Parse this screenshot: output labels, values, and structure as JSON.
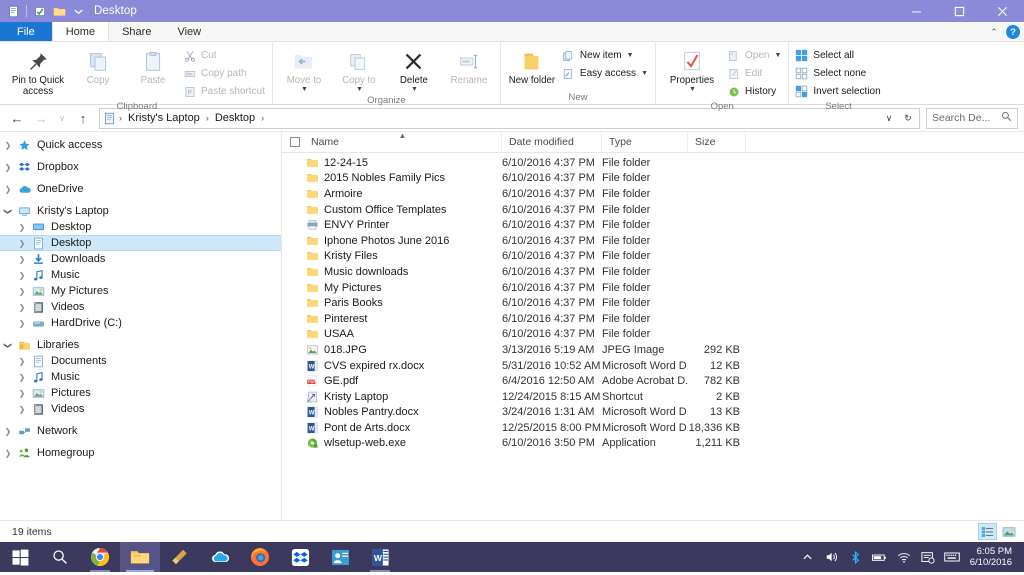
{
  "window": {
    "title": "Desktop",
    "titlebar_color": "#8a8ad8",
    "quick_access": [
      {
        "name": "properties-icon",
        "label": "Properties"
      },
      {
        "name": "new-folder-check-icon",
        "label": "New folder"
      },
      {
        "name": "folder-icon",
        "label": "Folder"
      },
      {
        "name": "customize-dropdown-icon",
        "label": "Customize Quick Access Toolbar"
      }
    ],
    "controls": {
      "minimize": "─",
      "maximize": "❐",
      "close": "✕"
    }
  },
  "tabs": [
    {
      "label": "File",
      "kind": "file"
    },
    {
      "label": "Home",
      "kind": "active"
    },
    {
      "label": "Share",
      "kind": "normal"
    },
    {
      "label": "View",
      "kind": "normal"
    }
  ],
  "ribbon_controls": {
    "collapse": "⌃",
    "help": "?"
  },
  "ribbon": {
    "groups": [
      {
        "label": "Clipboard",
        "big": [
          {
            "label": "Pin to Quick access",
            "icon": "pin-icon",
            "dim": false
          },
          {
            "label": "Copy",
            "icon": "copy-icon",
            "dim": true
          },
          {
            "label": "Paste",
            "icon": "paste-icon",
            "dim": true
          }
        ],
        "small": [
          {
            "label": "Cut",
            "icon": "scissors-icon",
            "dim": true
          },
          {
            "label": "Copy path",
            "icon": "copy-path-icon",
            "dim": true
          },
          {
            "label": "Paste shortcut",
            "icon": "paste-shortcut-icon",
            "dim": true
          }
        ]
      },
      {
        "label": "Organize",
        "big": [
          {
            "label": "Move to",
            "icon": "move-to-icon",
            "dim": true,
            "caret": true
          },
          {
            "label": "Copy to",
            "icon": "copy-to-icon",
            "dim": true,
            "caret": true
          },
          {
            "label": "Delete",
            "icon": "delete-icon",
            "dim": false,
            "caret": true
          },
          {
            "label": "Rename",
            "icon": "rename-icon",
            "dim": true
          }
        ],
        "small": []
      },
      {
        "label": "New",
        "big": [
          {
            "label": "New folder",
            "icon": "new-folder-icon",
            "dim": false
          }
        ],
        "small": [
          {
            "label": "New item",
            "icon": "new-item-icon",
            "dim": false,
            "caret": true
          },
          {
            "label": "Easy access",
            "icon": "easy-access-icon",
            "dim": false,
            "caret": true
          }
        ]
      },
      {
        "label": "Open",
        "big": [
          {
            "label": "Properties",
            "icon": "properties-icon",
            "dim": false,
            "caret": true
          }
        ],
        "small": [
          {
            "label": "Open",
            "icon": "open-icon",
            "dim": true,
            "caret": true
          },
          {
            "label": "Edit",
            "icon": "edit-icon",
            "dim": true
          },
          {
            "label": "History",
            "icon": "history-icon",
            "dim": false
          }
        ]
      },
      {
        "label": "Select",
        "big": [],
        "small": [
          {
            "label": "Select all",
            "icon": "select-all-icon",
            "dim": false
          },
          {
            "label": "Select none",
            "icon": "select-none-icon",
            "dim": false
          },
          {
            "label": "Invert selection",
            "icon": "invert-selection-icon",
            "dim": false
          }
        ]
      }
    ]
  },
  "address": {
    "back": "←",
    "forward": "→",
    "recent": "∨",
    "up": "↑",
    "crumbs": [
      "Kristy's Laptop",
      "Desktop"
    ],
    "separator": "›",
    "dropdown": "∨",
    "refresh": "↻",
    "search_placeholder": "Search De...",
    "search_value": ""
  },
  "sidebar": {
    "items": [
      {
        "label": "Quick access",
        "icon": "star-icon",
        "level": 0,
        "twisty": "collapsed",
        "selected": false,
        "gap": false
      },
      {
        "label": "Dropbox",
        "icon": "dropbox-icon",
        "level": 0,
        "twisty": "collapsed",
        "selected": false,
        "gap": true
      },
      {
        "label": "OneDrive",
        "icon": "onedrive-icon",
        "level": 0,
        "twisty": "collapsed",
        "selected": false,
        "gap": true
      },
      {
        "label": "Kristy's Laptop",
        "icon": "computer-icon",
        "level": 0,
        "twisty": "expanded",
        "selected": false,
        "gap": true
      },
      {
        "label": "Desktop",
        "icon": "desktop-icon",
        "level": 1,
        "twisty": "collapsed",
        "selected": false,
        "gap": false
      },
      {
        "label": "Desktop",
        "icon": "documents-icon",
        "level": 1,
        "twisty": "collapsed",
        "selected": true,
        "gap": false
      },
      {
        "label": "Downloads",
        "icon": "downloads-icon",
        "level": 1,
        "twisty": "collapsed",
        "selected": false,
        "gap": false
      },
      {
        "label": "Music",
        "icon": "music-icon",
        "level": 1,
        "twisty": "collapsed",
        "selected": false,
        "gap": false
      },
      {
        "label": "My Pictures",
        "icon": "pictures-icon",
        "level": 1,
        "twisty": "collapsed",
        "selected": false,
        "gap": false
      },
      {
        "label": "Videos",
        "icon": "videos-icon",
        "level": 1,
        "twisty": "collapsed",
        "selected": false,
        "gap": false
      },
      {
        "label": "HardDrive (C:)",
        "icon": "harddrive-icon",
        "level": 1,
        "twisty": "collapsed",
        "selected": false,
        "gap": false
      },
      {
        "label": "Libraries",
        "icon": "libraries-icon",
        "level": 0,
        "twisty": "expanded",
        "selected": false,
        "gap": true
      },
      {
        "label": "Documents",
        "icon": "documents-icon",
        "level": 1,
        "twisty": "collapsed",
        "selected": false,
        "gap": false
      },
      {
        "label": "Music",
        "icon": "music-icon",
        "level": 1,
        "twisty": "collapsed",
        "selected": false,
        "gap": false
      },
      {
        "label": "Pictures",
        "icon": "pictures-icon",
        "level": 1,
        "twisty": "collapsed",
        "selected": false,
        "gap": false
      },
      {
        "label": "Videos",
        "icon": "videos-icon",
        "level": 1,
        "twisty": "collapsed",
        "selected": false,
        "gap": false
      },
      {
        "label": "Network",
        "icon": "network-icon",
        "level": 0,
        "twisty": "collapsed",
        "selected": false,
        "gap": true
      },
      {
        "label": "Homegroup",
        "icon": "homegroup-icon",
        "level": 0,
        "twisty": "collapsed",
        "selected": false,
        "gap": true
      }
    ],
    "selection_color": "#cce8f9"
  },
  "filelist": {
    "columns": [
      {
        "label": "Name",
        "key": "name",
        "sorted": "asc"
      },
      {
        "label": "Date modified",
        "key": "date"
      },
      {
        "label": "Type",
        "key": "type"
      },
      {
        "label": "Size",
        "key": "size"
      }
    ],
    "rows": [
      {
        "name": "12-24-15",
        "date": "6/10/2016 4:37 PM",
        "type": "File folder",
        "size": "",
        "icon": "folder-icon"
      },
      {
        "name": "2015 Nobles Family Pics",
        "date": "6/10/2016 4:37 PM",
        "type": "File folder",
        "size": "",
        "icon": "folder-icon"
      },
      {
        "name": "Armoire",
        "date": "6/10/2016 4:37 PM",
        "type": "File folder",
        "size": "",
        "icon": "folder-icon"
      },
      {
        "name": "Custom Office Templates",
        "date": "6/10/2016 4:37 PM",
        "type": "File folder",
        "size": "",
        "icon": "folder-icon"
      },
      {
        "name": "ENVY Printer",
        "date": "6/10/2016 4:37 PM",
        "type": "File folder",
        "size": "",
        "icon": "printer-icon"
      },
      {
        "name": "Iphone Photos June 2016",
        "date": "6/10/2016 4:37 PM",
        "type": "File folder",
        "size": "",
        "icon": "folder-icon"
      },
      {
        "name": "Kristy Files",
        "date": "6/10/2016 4:37 PM",
        "type": "File folder",
        "size": "",
        "icon": "folder-icon"
      },
      {
        "name": "Music downloads",
        "date": "6/10/2016 4:37 PM",
        "type": "File folder",
        "size": "",
        "icon": "folder-icon"
      },
      {
        "name": "My Pictures",
        "date": "6/10/2016 4:37 PM",
        "type": "File folder",
        "size": "",
        "icon": "folder-icon"
      },
      {
        "name": "Paris Books",
        "date": "6/10/2016 4:37 PM",
        "type": "File folder",
        "size": "",
        "icon": "folder-icon"
      },
      {
        "name": "Pinterest",
        "date": "6/10/2016 4:37 PM",
        "type": "File folder",
        "size": "",
        "icon": "folder-icon"
      },
      {
        "name": "USAA",
        "date": "6/10/2016 4:37 PM",
        "type": "File folder",
        "size": "",
        "icon": "folder-icon"
      },
      {
        "name": "018.JPG",
        "date": "3/13/2016 5:19 AM",
        "type": "JPEG Image",
        "size": "292 KB",
        "icon": "image-icon"
      },
      {
        "name": "CVS expired rx.docx",
        "date": "5/31/2016 10:52 AM",
        "type": "Microsoft Word D...",
        "size": "12 KB",
        "icon": "word-icon"
      },
      {
        "name": "GE.pdf",
        "date": "6/4/2016 12:50 AM",
        "type": "Adobe Acrobat D...",
        "size": "782 KB",
        "icon": "pdf-icon"
      },
      {
        "name": "Kristy Laptop",
        "date": "12/24/2015 8:15 AM",
        "type": "Shortcut",
        "size": "2 KB",
        "icon": "shortcut-icon"
      },
      {
        "name": "Nobles Pantry.docx",
        "date": "3/24/2016 1:31 AM",
        "type": "Microsoft Word D...",
        "size": "13 KB",
        "icon": "word-icon"
      },
      {
        "name": "Pont de Arts.docx",
        "date": "12/25/2015 8:00 PM",
        "type": "Microsoft Word D...",
        "size": "18,336 KB",
        "icon": "word-icon"
      },
      {
        "name": "wlsetup-web.exe",
        "date": "6/10/2016 3:50 PM",
        "type": "Application",
        "size": "1,211 KB",
        "icon": "exe-icon"
      }
    ]
  },
  "statusbar": {
    "item_count": "19 items",
    "views": [
      {
        "name": "details-view-button",
        "label": "Details view",
        "active": true
      },
      {
        "name": "large-icons-view-button",
        "label": "Large icons view",
        "active": false
      }
    ]
  },
  "taskbar": {
    "background": "#3b3a5e",
    "buttons": [
      {
        "name": "start-button",
        "label": "Start",
        "state": "none"
      },
      {
        "name": "search-button",
        "label": "Search",
        "state": "none"
      },
      {
        "name": "chrome-button",
        "label": "Google Chrome",
        "state": "running"
      },
      {
        "name": "file-explorer-button",
        "label": "File Explorer",
        "state": "active"
      },
      {
        "name": "cleaner-button",
        "label": "CCleaner",
        "state": "none"
      },
      {
        "name": "onedrive-button",
        "label": "OneDrive",
        "state": "none"
      },
      {
        "name": "firefox-button",
        "label": "Mozilla Firefox",
        "state": "none"
      },
      {
        "name": "dropbox-button",
        "label": "Dropbox",
        "state": "none"
      },
      {
        "name": "skype-button",
        "label": "Skype",
        "state": "none"
      },
      {
        "name": "word-button",
        "label": "Microsoft Word",
        "state": "running"
      }
    ],
    "tray": [
      {
        "name": "show-hidden-icons-button",
        "label": "Show hidden icons"
      },
      {
        "name": "volume-icon",
        "label": "Volume"
      },
      {
        "name": "bluetooth-icon",
        "label": "Bluetooth"
      },
      {
        "name": "battery-icon",
        "label": "Battery"
      },
      {
        "name": "wifi-icon",
        "label": "Network"
      },
      {
        "name": "action-center-icon",
        "label": "Action Center"
      },
      {
        "name": "keyboard-icon",
        "label": "Touch keyboard"
      }
    ],
    "clock": {
      "time": "6:05 PM",
      "date": "6/10/2016"
    }
  }
}
